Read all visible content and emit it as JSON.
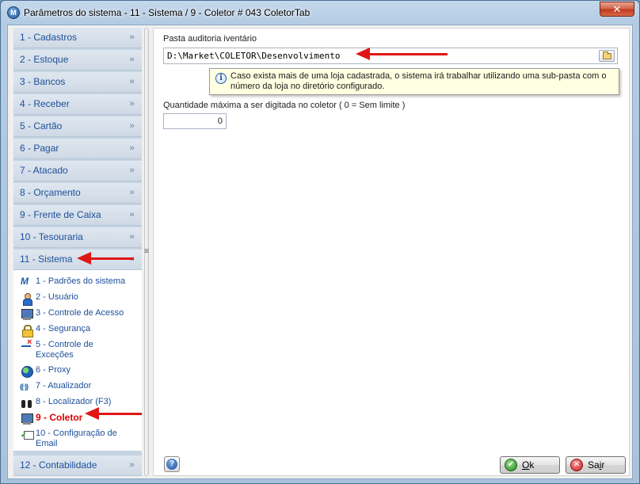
{
  "window": {
    "title": "Parâmetros do sistema - 11 - Sistema / 9 - Coletor # 043 ColetorTab",
    "app_icon_glyph": "M",
    "close_glyph": "✕"
  },
  "sidebar": {
    "groups": [
      {
        "label": "1 - Cadastros",
        "chevron": "»"
      },
      {
        "label": "2 - Estoque",
        "chevron": "»"
      },
      {
        "label": "3 - Bancos",
        "chevron": "»"
      },
      {
        "label": "4 - Receber",
        "chevron": "»"
      },
      {
        "label": "5 - Cartão",
        "chevron": "»"
      },
      {
        "label": "6 - Pagar",
        "chevron": "»"
      },
      {
        "label": "7 - Atacado",
        "chevron": "»"
      },
      {
        "label": "8 - Orçamento",
        "chevron": "»"
      },
      {
        "label": "9 - Frente de Caixa",
        "chevron": "»"
      },
      {
        "label": "10 - Tesouraria",
        "chevron": "»"
      },
      {
        "label": "11 - Sistema",
        "chevron": "«",
        "expanded": true
      },
      {
        "label": "12 - Contabilidade",
        "chevron": "»"
      }
    ],
    "sistema_items": [
      {
        "label": "1 - Padrões do sistema",
        "icon": "m-logo-icon"
      },
      {
        "label": "2 - Usuário",
        "icon": "user-icon"
      },
      {
        "label": "3 - Controle de Acesso",
        "icon": "computer-icon"
      },
      {
        "label": "4 - Segurança",
        "icon": "lock-icon"
      },
      {
        "label": "5 - Controle de Exceções",
        "icon": "exception-icon"
      },
      {
        "label": "6 - Proxy",
        "icon": "globe-icon"
      },
      {
        "label": "7 - Atualizador",
        "icon": "update-icon"
      },
      {
        "label": "8 - Localizador (F3)",
        "icon": "binoculars-icon"
      },
      {
        "label": "9 - Coletor",
        "icon": "computer-icon",
        "selected": true
      },
      {
        "label": "10 - Configuração de Email",
        "icon": "email-config-icon"
      }
    ]
  },
  "splitter": {
    "grip": "≡"
  },
  "main": {
    "audit_folder_label": "Pasta auditoria iventário",
    "audit_folder_value": "D:\\Market\\COLETOR\\Desenvolvimento",
    "tooltip_icon": "i",
    "tooltip_text": "Caso exista mais de uma loja cadastrada, o sistema irá trabalhar utilizando uma sub-pasta com o número da loja no diretório configurado.",
    "max_qty_label": "Quantidade máxima a ser digitada no coletor ( 0 = Sem limite )",
    "max_qty_value": "0"
  },
  "footer": {
    "help_glyph": "?",
    "ok_mnemonic": "O",
    "ok_rest": "k",
    "ok_glyph": "✔",
    "exit_prefix": "Sa",
    "exit_mnemonic": "i",
    "exit_rest": "r",
    "exit_glyph": "✕"
  },
  "colors": {
    "annotation_arrow": "#e01616",
    "selected_item_text": "#e00000",
    "group_text": "#1d4f9a"
  }
}
